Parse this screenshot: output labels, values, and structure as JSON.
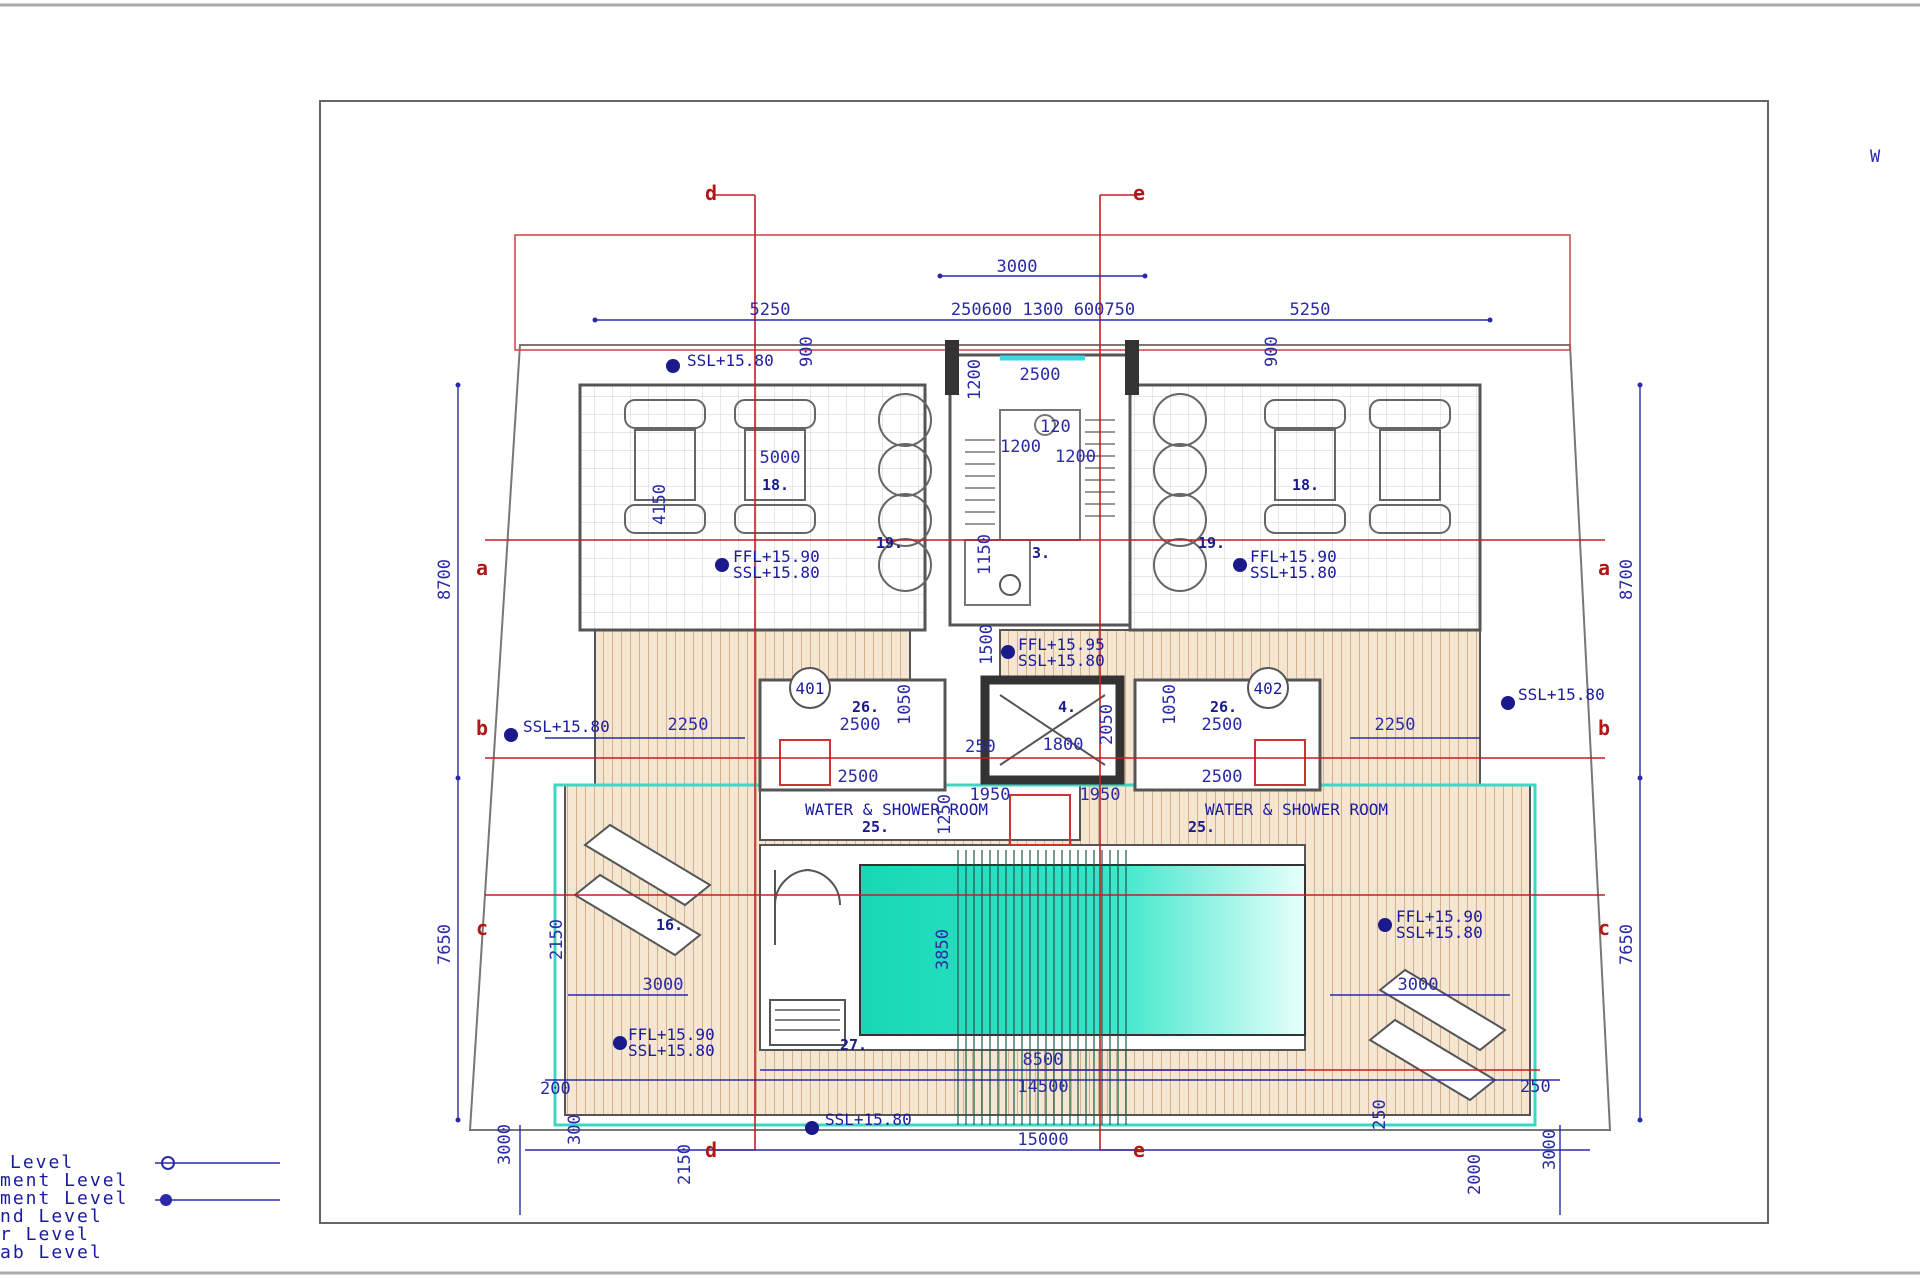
{
  "top_dims": {
    "overall": "3000",
    "left": "5250",
    "center": "250600 1300 600750",
    "right": "5250"
  },
  "core_dims": {
    "stair_width": "2500",
    "d1": "1200",
    "d2": "1200",
    "d3": "1200",
    "d4": "120",
    "d5": "1500",
    "d6": "1150",
    "d7": "2050"
  },
  "left_room": {
    "number": "18.",
    "bath": "19.",
    "width": "5000",
    "depth": "4150",
    "offset": "900"
  },
  "right_room": {
    "number": "18.",
    "bath": "19.",
    "offset": "900"
  },
  "core": {
    "stair_number": "3.",
    "lift_number": "4.",
    "lift_dim": "1800",
    "lift_dim2": "250"
  },
  "wc_left": {
    "number": "26.",
    "width": "2500",
    "w2": "2500",
    "d": "1050",
    "badge": "401"
  },
  "wc_right": {
    "number": "26.",
    "width": "2500",
    "w2": "2500",
    "d": "1050",
    "badge": "402"
  },
  "plant_left": {
    "number": "25.",
    "label": "WATER & SHOWER ROOM"
  },
  "plant_right": {
    "number": "25.",
    "label": "WATER & SHOWER ROOM"
  },
  "pool": {
    "number": "27.",
    "depth": "3850",
    "width": "8500",
    "stairs_dim": "1950"
  },
  "terrace": {
    "number": "16.",
    "left_dim": "3000",
    "right_dim": "3000",
    "left_side": "2250",
    "right_side": "2250"
  },
  "bottom_dims": {
    "overall": "15000",
    "inner": "14500",
    "b1": "200",
    "b2": "300",
    "b3": "3000",
    "b4": "2150",
    "b5": "2000",
    "b6": "3000",
    "b7": "250",
    "b8": "250"
  },
  "side_dims": {
    "left_upper": "8700",
    "left_lower": "7650",
    "right_upper": "8700",
    "right_lower": "7650",
    "left_mid": "2150",
    "core_v": "1250"
  },
  "levels": {
    "ssl_top": "SSL+15.80",
    "ffl_left": "FFL+15.90",
    "ssl_left": "SSL+15.80",
    "ffl_right": "FFL+15.90",
    "ssl_right": "SSL+15.80",
    "ffl_core": "FFL+15.95",
    "ssl_core": "SSL+15.80",
    "ssl_mid_left": "SSL+15.80",
    "ssl_mid_right": "SSL+15.80",
    "ffl_terr_left": "FFL+15.90",
    "ssl_terr_left": "SSL+15.80",
    "ffl_terr_right": "FFL+15.90",
    "ssl_terr_right": "SSL+15.80",
    "ssl_bottom": "SSL+15.80"
  },
  "grid_labels": {
    "top_left": "d",
    "top_right": "e",
    "bot_left": "d",
    "bot_right": "e",
    "row_a": "a",
    "row_b": "b",
    "row_c": "c"
  },
  "legend": [
    "Level",
    "ment Level",
    "ment Level",
    "nd Level",
    "r Level",
    "ab Level"
  ],
  "colors": {
    "line": "#4a4a4a",
    "grid": "#c02020",
    "dim": "#2a2aa8",
    "pool": "#1ee0c0",
    "deck": "#e8c8a0"
  }
}
